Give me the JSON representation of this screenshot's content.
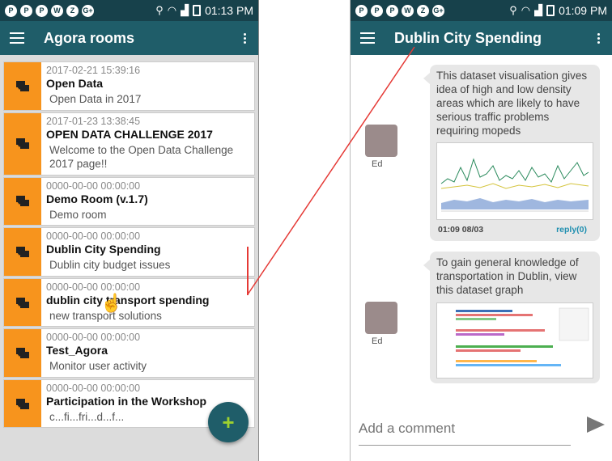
{
  "left": {
    "status": {
      "time": "01:13 PM",
      "icons": [
        "P",
        "P",
        "P",
        "W",
        "Z",
        "G+"
      ]
    },
    "appbar": {
      "title": "Agora rooms"
    },
    "rooms": [
      {
        "date": "2017-02-21 15:39:16",
        "name": "Open Data",
        "desc": "Open Data in 2017"
      },
      {
        "date": "2017-01-23 13:38:45",
        "name": "OPEN DATA CHALLENGE 2017",
        "desc": "Welcome to the Open Data Challenge 2017 page!!"
      },
      {
        "date": "0000-00-00 00:00:00",
        "name": "Demo Room (v.1.7)",
        "desc": "Demo room"
      },
      {
        "date": "0000-00-00 00:00:00",
        "name": "Dublin City Spending",
        "desc": "Dublin city budget issues"
      },
      {
        "date": "0000-00-00 00:00:00",
        "name": "dublin city transport spending",
        "desc": "new transport solutions"
      },
      {
        "date": "0000-00-00 00:00:00",
        "name": "Test_Agora",
        "desc": "Monitor user activity"
      },
      {
        "date": "0000-00-00 00:00:00",
        "name": "Participation in the Workshop",
        "desc": "c...fi...fri...d...f..."
      }
    ],
    "fab": {
      "label": "+"
    }
  },
  "right": {
    "status": {
      "time": "01:09 PM",
      "icons": [
        "P",
        "P",
        "P",
        "W",
        "Z",
        "G+"
      ]
    },
    "appbar": {
      "title": "Dublin City Spending"
    },
    "messages": [
      {
        "author": "Ed",
        "text": "This dataset visualisation gives idea of high and low density areas which are likely to have serious traffic problems requiring mopeds",
        "time": "01:09 08/03",
        "reply": "reply(0)"
      },
      {
        "author": "Ed",
        "text": "To gain general knowledge of transportation in Dublin, view this dataset graph"
      }
    ],
    "comment": {
      "placeholder": "Add a comment"
    }
  },
  "colors": {
    "status_bg": "#17414b",
    "appbar_bg": "#1f5d69",
    "room_accent": "#f7941d",
    "fab_plus": "#9ed12f",
    "annotation": "#e53935"
  }
}
